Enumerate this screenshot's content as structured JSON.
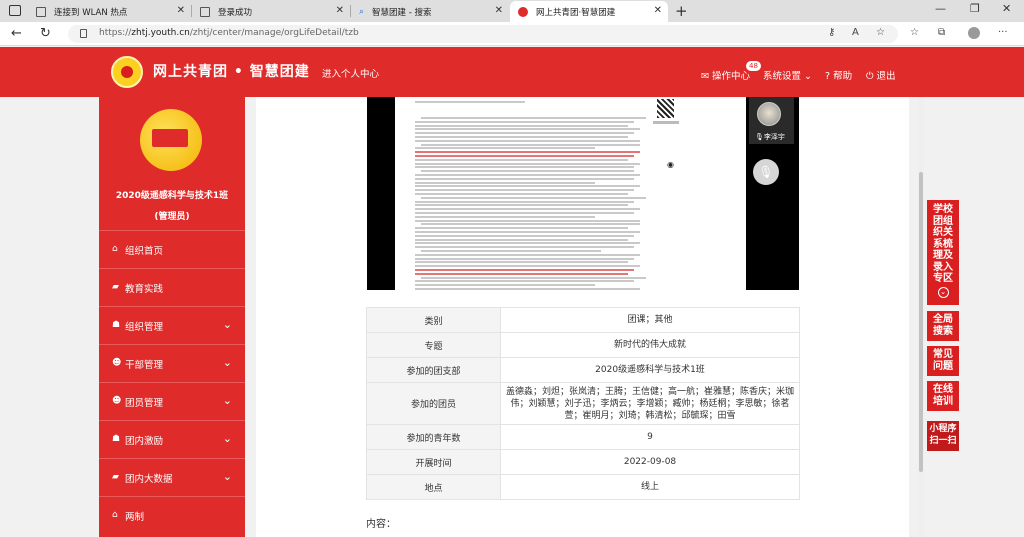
{
  "browser": {
    "tabs": [
      {
        "title": "连接到 WLAN 热点"
      },
      {
        "title": "登录成功"
      },
      {
        "title": "智慧团建 - 搜索"
      },
      {
        "title": "网上共青团·智慧团建"
      }
    ],
    "url_prefix": "https://",
    "url_host": "zhtj.youth.cn",
    "url_path": "/zhtj/center/manage/orgLifeDetail/tzb"
  },
  "header": {
    "site_title": "网上共青团 • 智慧团建",
    "personal_center": "进入个人中心",
    "operations": "操作中心",
    "operations_badge": "48",
    "settings": "系统设置",
    "help": "帮助",
    "logout": "退出"
  },
  "sidebar": {
    "org_name": "2020级遥感科学与技术1班",
    "role": "(管理员)",
    "items": [
      {
        "label": "组织首页",
        "icon": "home-icon",
        "expandable": false
      },
      {
        "label": "教育实践",
        "icon": "folder-icon",
        "expandable": false
      },
      {
        "label": "组织管理",
        "icon": "sitemap-icon",
        "expandable": true
      },
      {
        "label": "干部管理",
        "icon": "users-icon",
        "expandable": true
      },
      {
        "label": "团员管理",
        "icon": "users-icon",
        "expandable": true
      },
      {
        "label": "团内激励",
        "icon": "sitemap-icon",
        "expandable": true
      },
      {
        "label": "团内大数据",
        "icon": "folder-icon",
        "expandable": true
      },
      {
        "label": "两制",
        "icon": "home-icon",
        "expandable": false
      }
    ]
  },
  "video": {
    "speaker_name": "李泽宇"
  },
  "details": [
    {
      "label": "类别",
      "value": "团课；其他"
    },
    {
      "label": "专题",
      "value": "新时代的伟大成就"
    },
    {
      "label": "参加的团支部",
      "value": "2020级遥感科学与技术1班"
    },
    {
      "label": "参加的团员",
      "value": "盖德淼；刘炟；张岚清；王腾；王信健；高一航；崔雅慧；陈香庆；米珈伟；刘颖慧；刘子迅；李炳云；李增颖；臧帅；杨廷桐；李思敏；徐茗萱；崔明月；刘琦；韩清松；邱毓琛；田雪"
    },
    {
      "label": "参加的青年数",
      "value": "9"
    },
    {
      "label": "开展时间",
      "value": "2022-09-08"
    },
    {
      "label": "地点",
      "value": "线上"
    }
  ],
  "content_label": "内容：",
  "float_panel": {
    "org_system": "学校团组织关系梳理及录入专区",
    "search": "全局搜索",
    "faq": "常见问题",
    "training": "在线培训",
    "miniprogram": "小程序扫一扫"
  },
  "colors": {
    "brand_red": "#e02b2b",
    "float_red": "#d91f1f"
  }
}
